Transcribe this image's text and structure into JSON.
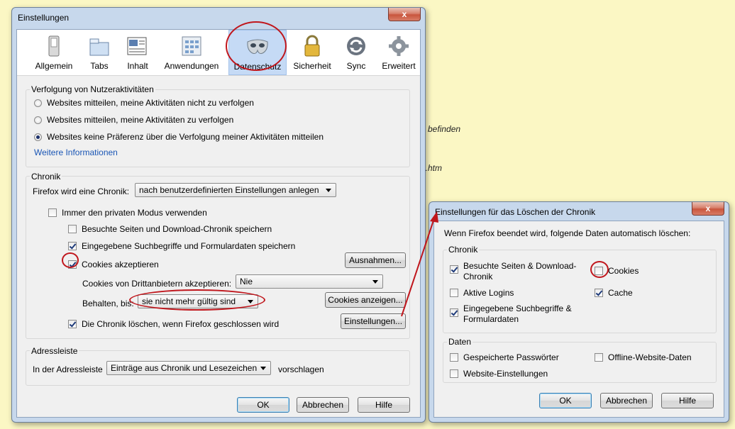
{
  "background_fragments": [
    "n befinden",
    "o.htm"
  ],
  "main_window": {
    "title": "Einstellungen",
    "close_glyph": "x",
    "toolbar": [
      {
        "label": "Allgemein",
        "icon": "switch-icon"
      },
      {
        "label": "Tabs",
        "icon": "tabs-icon"
      },
      {
        "label": "Inhalt",
        "icon": "content-icon"
      },
      {
        "label": "Anwendungen",
        "icon": "applications-icon"
      },
      {
        "label": "Datenschutz",
        "icon": "mask-icon"
      },
      {
        "label": "Sicherheit",
        "icon": "lock-icon"
      },
      {
        "label": "Sync",
        "icon": "sync-icon"
      },
      {
        "label": "Erweitert",
        "icon": "gear-icon"
      }
    ],
    "tracking": {
      "title": "Verfolgung von Nutzeraktivitäten",
      "opt1": "Websites mitteilen, meine Aktivitäten nicht zu verfolgen",
      "opt2": "Websites mitteilen, meine Aktivitäten zu verfolgen",
      "opt3": "Websites keine Präferenz über die Verfolgung meiner Aktivitäten mitteilen",
      "more_info": "Weitere Informationen"
    },
    "history": {
      "title": "Chronik",
      "firefox_will": "Firefox wird eine Chronik:",
      "mode_value": "nach benutzerdefinierten Einstellungen anlegen",
      "private_mode": "Immer den privaten Modus verwenden",
      "visited": "Besuchte Seiten und Download-Chronik speichern",
      "form_data": "Eingegebene Suchbegriffe und Formulardaten speichern",
      "accept_cookies": "Cookies akzeptieren",
      "exceptions_btn": "Ausnahmen...",
      "third_party": "Cookies von Drittanbietern akzeptieren:",
      "third_party_value": "Nie",
      "keep_until": "Behalten, bis:",
      "keep_until_value": "sie nicht mehr gültig sind",
      "show_cookies_btn": "Cookies anzeigen...",
      "clear_on_close": "Die Chronik löschen, wenn Firefox geschlossen wird",
      "settings_btn": "Einstellungen..."
    },
    "address_bar": {
      "title": "Adressleiste",
      "in_bar": "In der Adressleiste",
      "suggest_value": "Einträge aus Chronik und Lesezeichen",
      "suggest": "vorschlagen"
    },
    "buttons": {
      "ok": "OK",
      "cancel": "Abbrechen",
      "help": "Hilfe"
    }
  },
  "clear_window": {
    "title": "Einstellungen für das Löschen der Chronik",
    "close_glyph": "x",
    "intro": "Wenn Firefox beendet wird, folgende Daten automatisch löschen:",
    "history_group": "Chronik",
    "visited_l1": "Besuchte Seiten & Download-",
    "visited_l2": "Chronik",
    "cookies": "Cookies",
    "active_logins": "Aktive Logins",
    "cache": "Cache",
    "form_l1": "Eingegebene Suchbegriffe &",
    "form_l2": "Formulardaten",
    "data_group": "Daten",
    "saved_passwords": "Gespeicherte Passwörter",
    "offline_data": "Offline-Website-Daten",
    "site_settings": "Website-Einstellungen",
    "buttons": {
      "ok": "OK",
      "cancel": "Abbrechen",
      "help": "Hilfe"
    }
  },
  "colors": {
    "annotation": "#c0161c",
    "link": "#1a56b5",
    "selected_tab": "#c5daf5"
  }
}
